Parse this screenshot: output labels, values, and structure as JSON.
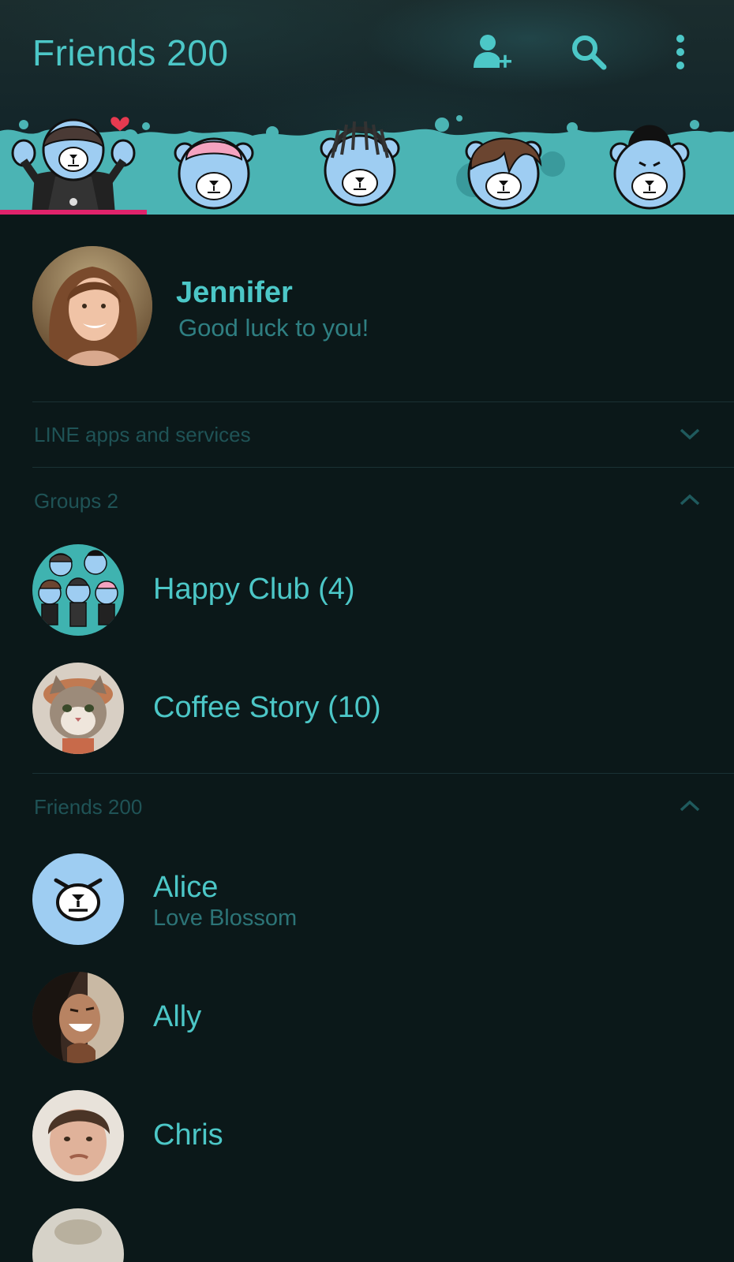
{
  "header": {
    "title": "Friends 200",
    "icons": [
      "add-friend-icon",
      "search-icon",
      "more-options-icon"
    ],
    "active_tab_color": "#e0236b",
    "accent": "#4cc7c7",
    "tabs": [
      {
        "name": "character-tab-1",
        "active": true
      },
      {
        "name": "character-tab-2",
        "active": false
      },
      {
        "name": "character-tab-3",
        "active": false
      },
      {
        "name": "character-tab-4",
        "active": false
      },
      {
        "name": "character-tab-5",
        "active": false
      }
    ]
  },
  "profile": {
    "name": "Jennifer",
    "status": "Good luck to you!"
  },
  "sections": {
    "services": {
      "label": "LINE apps and services",
      "state": "collapsed"
    },
    "groups": {
      "label": "Groups 2",
      "state": "expanded"
    },
    "friends": {
      "label": "Friends 200",
      "state": "expanded"
    }
  },
  "groups": [
    {
      "name": "Happy Club (4)"
    },
    {
      "name": "Coffee Story (10)"
    }
  ],
  "friends": [
    {
      "name": "Alice",
      "status": "Love Blossom"
    },
    {
      "name": "Ally",
      "status": ""
    },
    {
      "name": "Chris",
      "status": ""
    }
  ]
}
